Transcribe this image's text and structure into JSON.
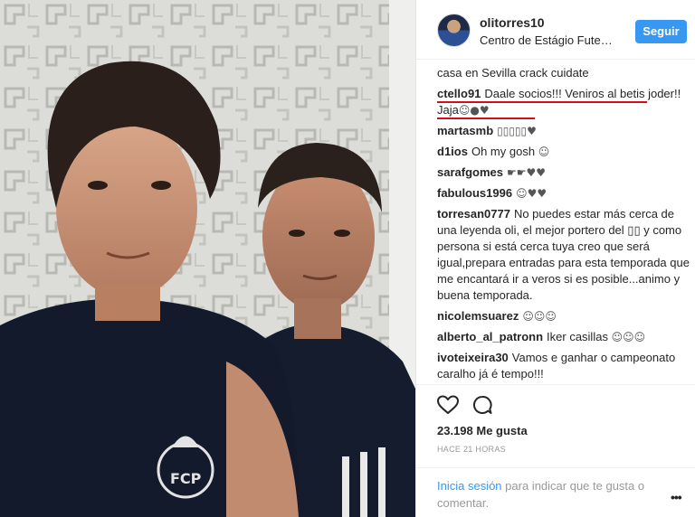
{
  "post": {
    "username": "olitorres10",
    "location": "Centro de Estágio Fute…",
    "follow_label": "Seguir"
  },
  "comments": [
    {
      "user": "",
      "text": "casa en Sevilla crack cuidate"
    },
    {
      "user": "ctello91",
      "text": "Daale socios!!! Veniros al betis joder!! Jaja",
      "emoji": "☺●♥"
    },
    {
      "user": "martasmb",
      "text": "",
      "emoji": "▯▯▯▯▯♥"
    },
    {
      "user": "d1ios",
      "text": "Oh my gosh",
      "emoji": "☺"
    },
    {
      "user": "sarafgomes",
      "text": "",
      "emoji": "☛☛♥♥"
    },
    {
      "user": "fabulous1996",
      "text": "",
      "emoji": "☺♥♥"
    },
    {
      "user": "torresan0777",
      "text": "No puedes estar más cerca de una leyenda oli, el mejor portero del ▯▯ y como persona si está cerca tuya creo que será igual,prepara entradas para esta temporada que me encantará ir a veros si es posible...animo y buena temporada."
    },
    {
      "user": "nicolemsuarez",
      "text": "",
      "emoji": "☺☺☺"
    },
    {
      "user": "alberto_al_patronn",
      "text": "Iker casillas",
      "emoji": "☺☺☺"
    },
    {
      "user": "ivoteixeira30",
      "text": "Vamos e ganhar o campeonato caralho já é tempo!!!"
    }
  ],
  "likes": "23.198 Me gusta",
  "time_ago": "HACE 21 HORAS",
  "login_prompt": {
    "link": "Inicia sesión",
    "rest": "para indicar que te gusta o comentar."
  },
  "icons": {
    "like": "heart-icon",
    "comment": "comment-icon",
    "more": "more-options-icon"
  },
  "colors": {
    "follow_button": "#3897f0",
    "highlight_underline": "#d40d1d",
    "link": "#3897f0"
  }
}
